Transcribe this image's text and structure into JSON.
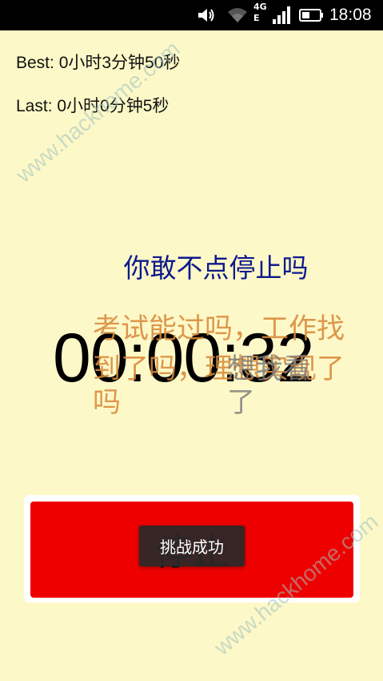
{
  "status_bar": {
    "time": "18:08",
    "network_label_top": "4G",
    "network_label_bottom": "E",
    "icons": [
      "volume-icon",
      "wifi-icon",
      "signal-icon",
      "battery-icon"
    ]
  },
  "stats": {
    "best": "Best: 0小时3分钟50秒",
    "last": "Last: 0小时0分钟5秒"
  },
  "prompt": "你敢不点停止吗",
  "timer": "00:00:32",
  "overlay_text": {
    "orange_line1": "考试能过吗，工作找",
    "orange_line2": "到了吗，理想实现了",
    "orange_line3": "吗",
    "gray_line1": "想我看",
    "gray_line2": "了"
  },
  "stop_button": {
    "label": "停止",
    "color": "#ee0000"
  },
  "toast": "挑战成功",
  "watermark": "www.hackhome.com"
}
